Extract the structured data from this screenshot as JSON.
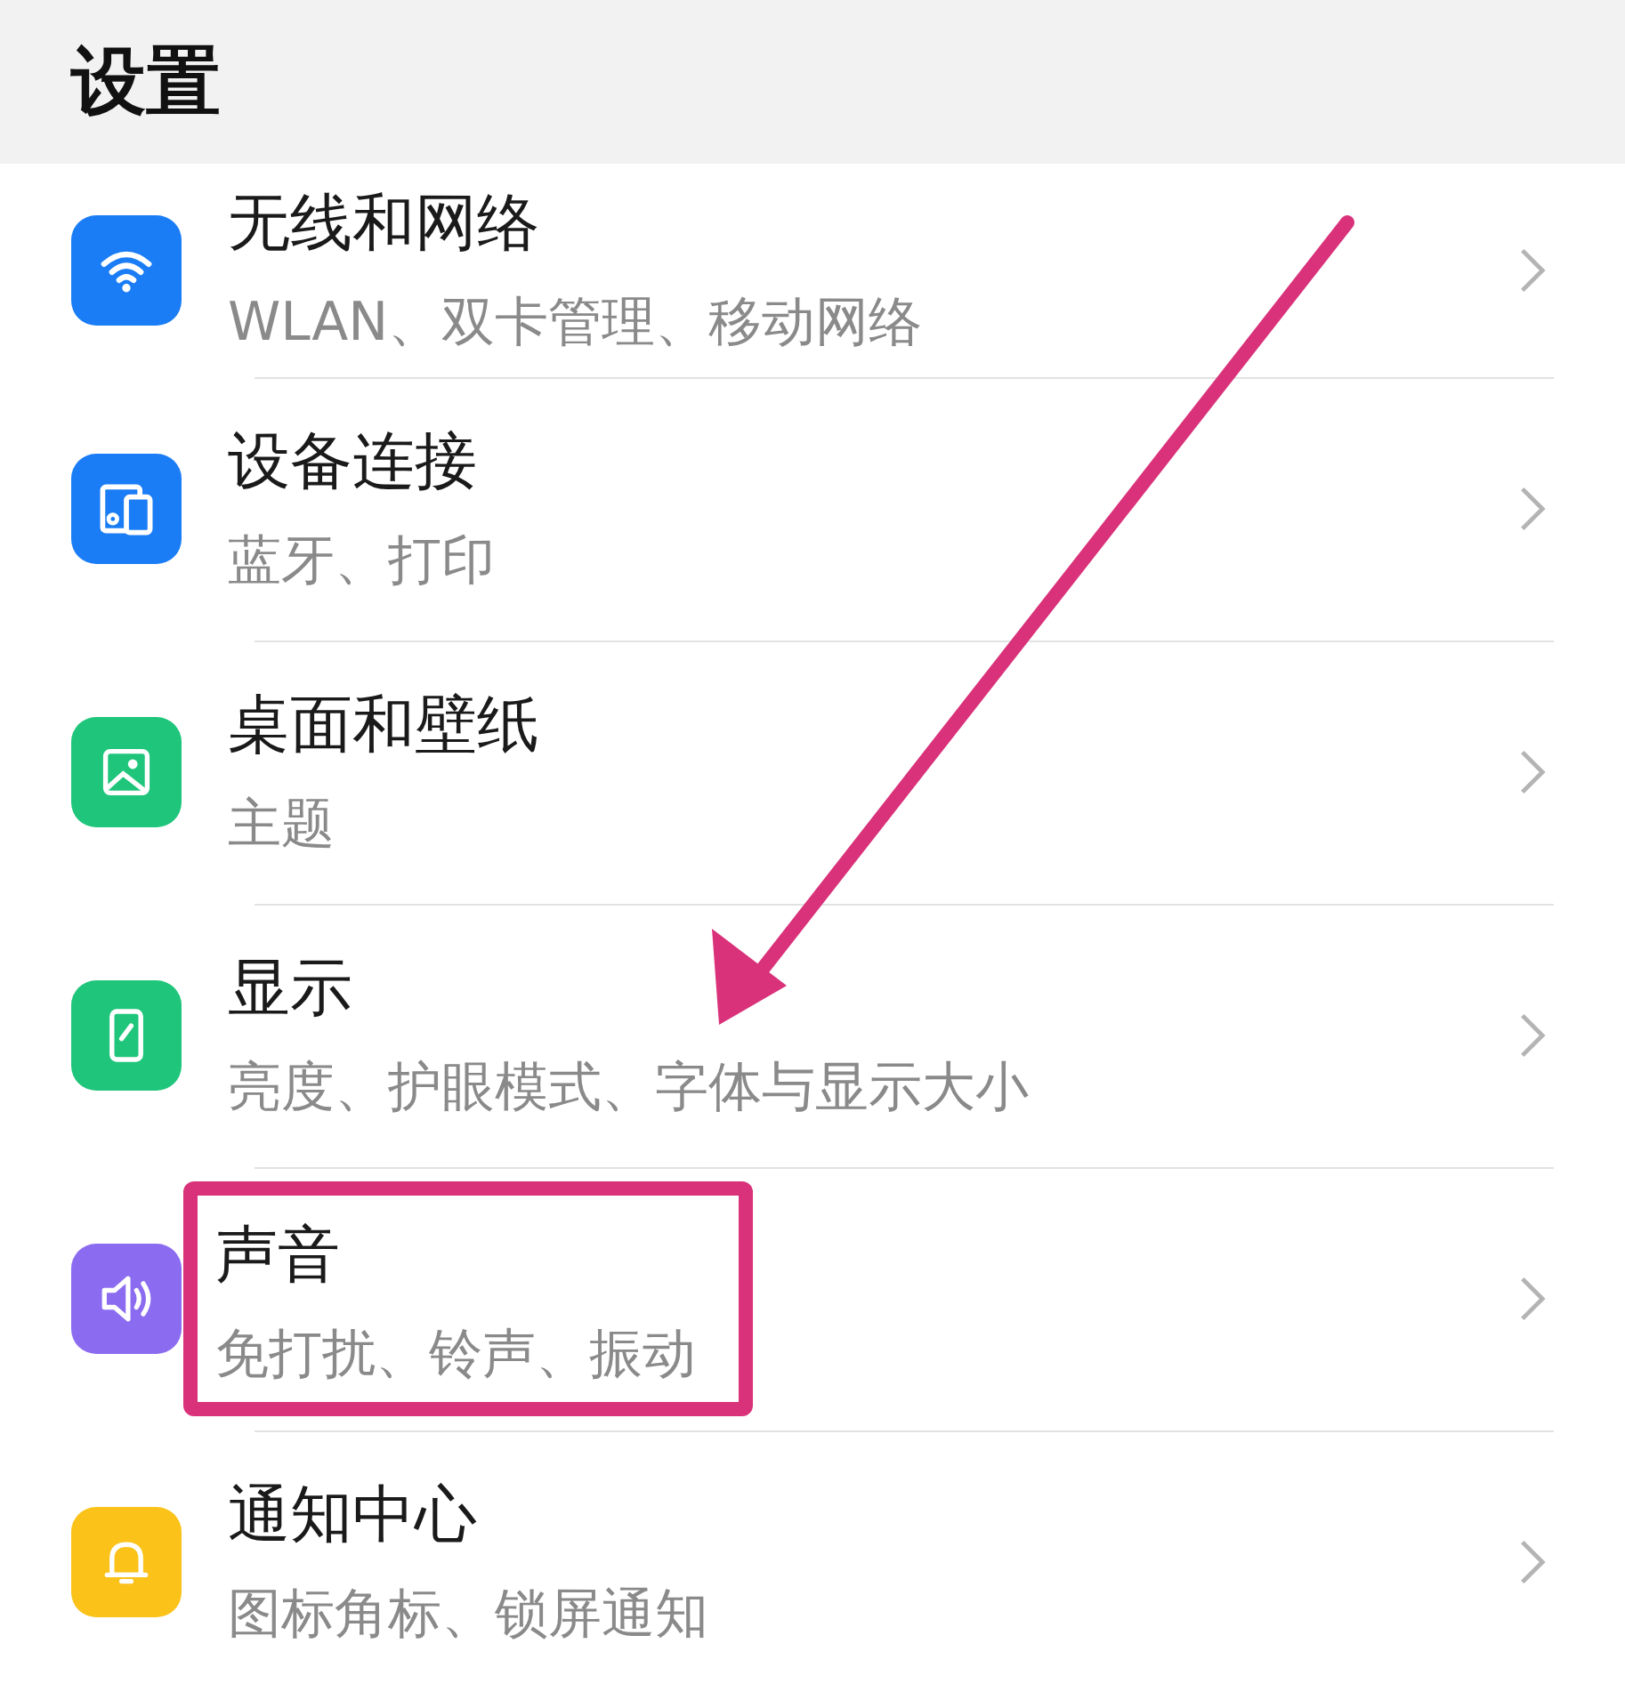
{
  "header": {
    "title": "设置"
  },
  "items": [
    {
      "kind": "wifi",
      "color": "#1a7df5",
      "title": "无线和网络",
      "subtitle": "WLAN、双卡管理、移动网络",
      "highlighted": false
    },
    {
      "kind": "devices",
      "color": "#1a7df5",
      "title": "设备连接",
      "subtitle": "蓝牙、打印",
      "highlighted": false
    },
    {
      "kind": "wallpaper",
      "color": "#1fc57a",
      "title": "桌面和壁纸",
      "subtitle": "主题",
      "highlighted": false
    },
    {
      "kind": "display",
      "color": "#1fc57a",
      "title": "显示",
      "subtitle": "亮度、护眼模式、字体与显示大小",
      "highlighted": false
    },
    {
      "kind": "sound",
      "color": "#8b6cf0",
      "title": "声音",
      "subtitle": "免打扰、铃声、振动",
      "highlighted": true
    },
    {
      "kind": "bell",
      "color": "#fbc21a",
      "title": "通知中心",
      "subtitle": "图标角标、锁屏通知",
      "highlighted": false
    }
  ]
}
